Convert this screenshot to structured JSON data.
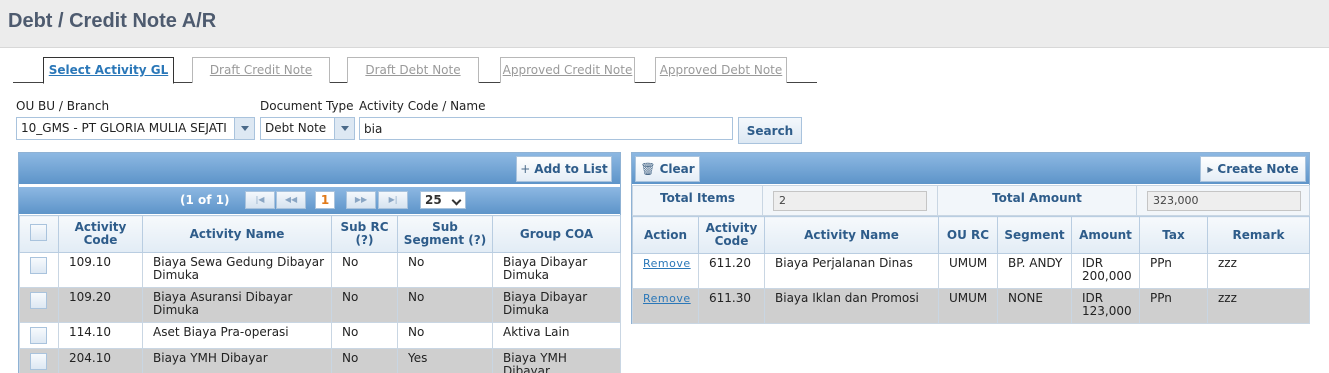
{
  "page": {
    "title": "Debt / Credit Note A/R"
  },
  "tabs": [
    {
      "label": "Select Activity GL",
      "active": true
    },
    {
      "label": "Draft Credit Note",
      "active": false
    },
    {
      "label": "Draft Debt Note",
      "active": false
    },
    {
      "label": "Approved Credit Note",
      "active": false
    },
    {
      "label": "Approved Debt Note",
      "active": false
    }
  ],
  "filters": {
    "ou_label": "OU BU / Branch",
    "ou_value": "10_GMS - PT GLORIA MULIA SEJATI",
    "doctype_label": "Document Type",
    "doctype_value": "Debt Note",
    "activity_label": "Activity Code / Name",
    "activity_value": "bia",
    "search_label": "Search"
  },
  "left_panel": {
    "add_label": "Add to List",
    "pager": {
      "text": "(1 of 1)",
      "current_page": "1",
      "page_size": "25"
    },
    "columns": [
      "Activity Code",
      "Activity Name",
      "Sub RC (?)",
      "Sub Segment (?)",
      "Group COA"
    ],
    "rows": [
      {
        "code": "109.10",
        "name": "Biaya Sewa Gedung Dibayar Dimuka",
        "sub_rc": "No",
        "sub_segment": "No",
        "group_coa": "Biaya Dibayar Dimuka"
      },
      {
        "code": "109.20",
        "name": "Biaya Asuransi Dibayar Dimuka",
        "sub_rc": "No",
        "sub_segment": "No",
        "group_coa": "Biaya Dibayar Dimuka"
      },
      {
        "code": "114.10",
        "name": "Aset Biaya Pra-operasi",
        "sub_rc": "No",
        "sub_segment": "No",
        "group_coa": "Aktiva Lain"
      },
      {
        "code": "204.10",
        "name": "Biaya YMH Dibayar",
        "sub_rc": "No",
        "sub_segment": "Yes",
        "group_coa": "Biaya YMH Dibayar"
      }
    ]
  },
  "right_panel": {
    "clear_label": "Clear",
    "create_label": "Create Note",
    "summary": {
      "total_items_label": "Total Items",
      "total_items_value": "2",
      "total_amount_label": "Total Amount",
      "total_amount_value": "323,000"
    },
    "columns": [
      "Action",
      "Activity Code",
      "Activity Name",
      "OU RC",
      "Segment",
      "Amount",
      "Tax",
      "Remark"
    ],
    "rows": [
      {
        "action": "Remove",
        "code": "611.20",
        "name": "Biaya Perjalanan Dinas",
        "ou_rc": "UMUM",
        "segment": "BP. ANDY",
        "amount": "IDR 200,000",
        "tax": "PPn",
        "remark": "zzz"
      },
      {
        "action": "Remove",
        "code": "611.30",
        "name": "Biaya Iklan dan Promosi",
        "ou_rc": "UMUM",
        "segment": "NONE",
        "amount": "IDR 123,000",
        "tax": "PPn",
        "remark": "zzz"
      }
    ]
  },
  "icons": {
    "add": "plus-icon",
    "clear": "trash-icon",
    "create": "triangle-right-icon",
    "first": "first-page-icon",
    "prev": "prev-page-icon",
    "next": "next-page-icon",
    "last": "last-page-icon"
  },
  "colors": {
    "accent": "#2a77b8",
    "toolbar": "#6fa3d6",
    "title": "#4e5b6f",
    "alt_row": "#cfcfcf"
  }
}
